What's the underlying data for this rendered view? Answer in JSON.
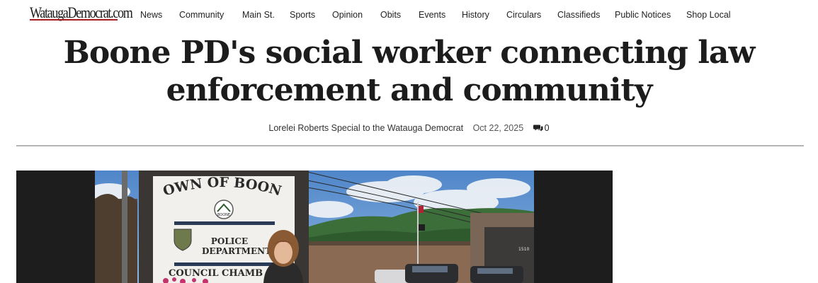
{
  "site": {
    "logo_text": "WataugaDemocrat.com"
  },
  "nav": {
    "items": [
      "News",
      "Community",
      "Main St.",
      "Sports",
      "Opinion",
      "Obits",
      "Events",
      "History",
      "Circulars",
      "Classifieds",
      "Public Notices",
      "Shop Local"
    ]
  },
  "article": {
    "headline": "Boone PD's social worker connecting law enforcement and community",
    "author": "Lorelei Roberts Special to the Watauga Democrat",
    "date": "Oct 22, 2025",
    "comment_count": "0"
  },
  "photo": {
    "sign": {
      "line1": "TOWN OF BOONE",
      "badge": "BOONE",
      "line2": "POLICE",
      "line3": "DEPARTMENT",
      "line4": "COUNCIL CHAMB"
    },
    "building_number": "1510"
  },
  "colors": {
    "logo_accent": "#a41e22",
    "text": "#1c1c1c",
    "rule": "#b5b5b5",
    "hero_bg": "#1d1d1d"
  },
  "icons": {
    "comments": "comments-icon"
  }
}
